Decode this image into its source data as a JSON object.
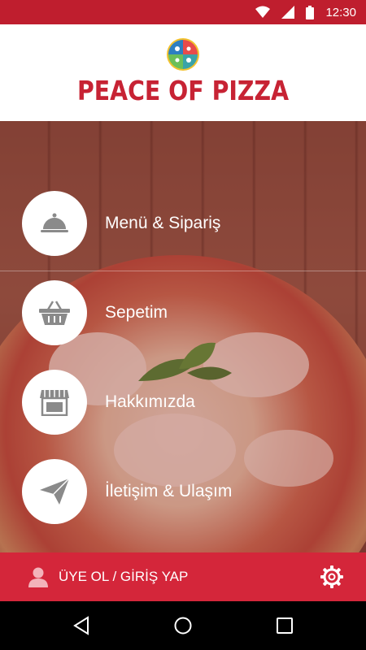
{
  "status_bar": {
    "time": "12:30",
    "icons": [
      "wifi-icon",
      "signal-icon",
      "battery-icon"
    ]
  },
  "brand": {
    "name": "PEACE OF PIZZA",
    "color": "#c72334"
  },
  "menu": [
    {
      "label": "Menü & Sipariş",
      "icon": "serving-cloche-icon"
    },
    {
      "label": "Sepetim",
      "icon": "basket-icon"
    },
    {
      "label": "Hakkımızda",
      "icon": "storefront-icon"
    },
    {
      "label": "İletişim & Ulaşım",
      "icon": "paper-plane-icon"
    }
  ],
  "footer": {
    "login_label": "ÜYE OL / GİRİŞ YAP",
    "icon": "user-icon",
    "settings_icon": "gear-icon",
    "color": "#d4263a"
  },
  "nav": [
    "back-icon",
    "home-icon",
    "recents-icon"
  ],
  "colors": {
    "status_bar": "#bf1e2e",
    "icon_gray": "#8a8a8a"
  }
}
